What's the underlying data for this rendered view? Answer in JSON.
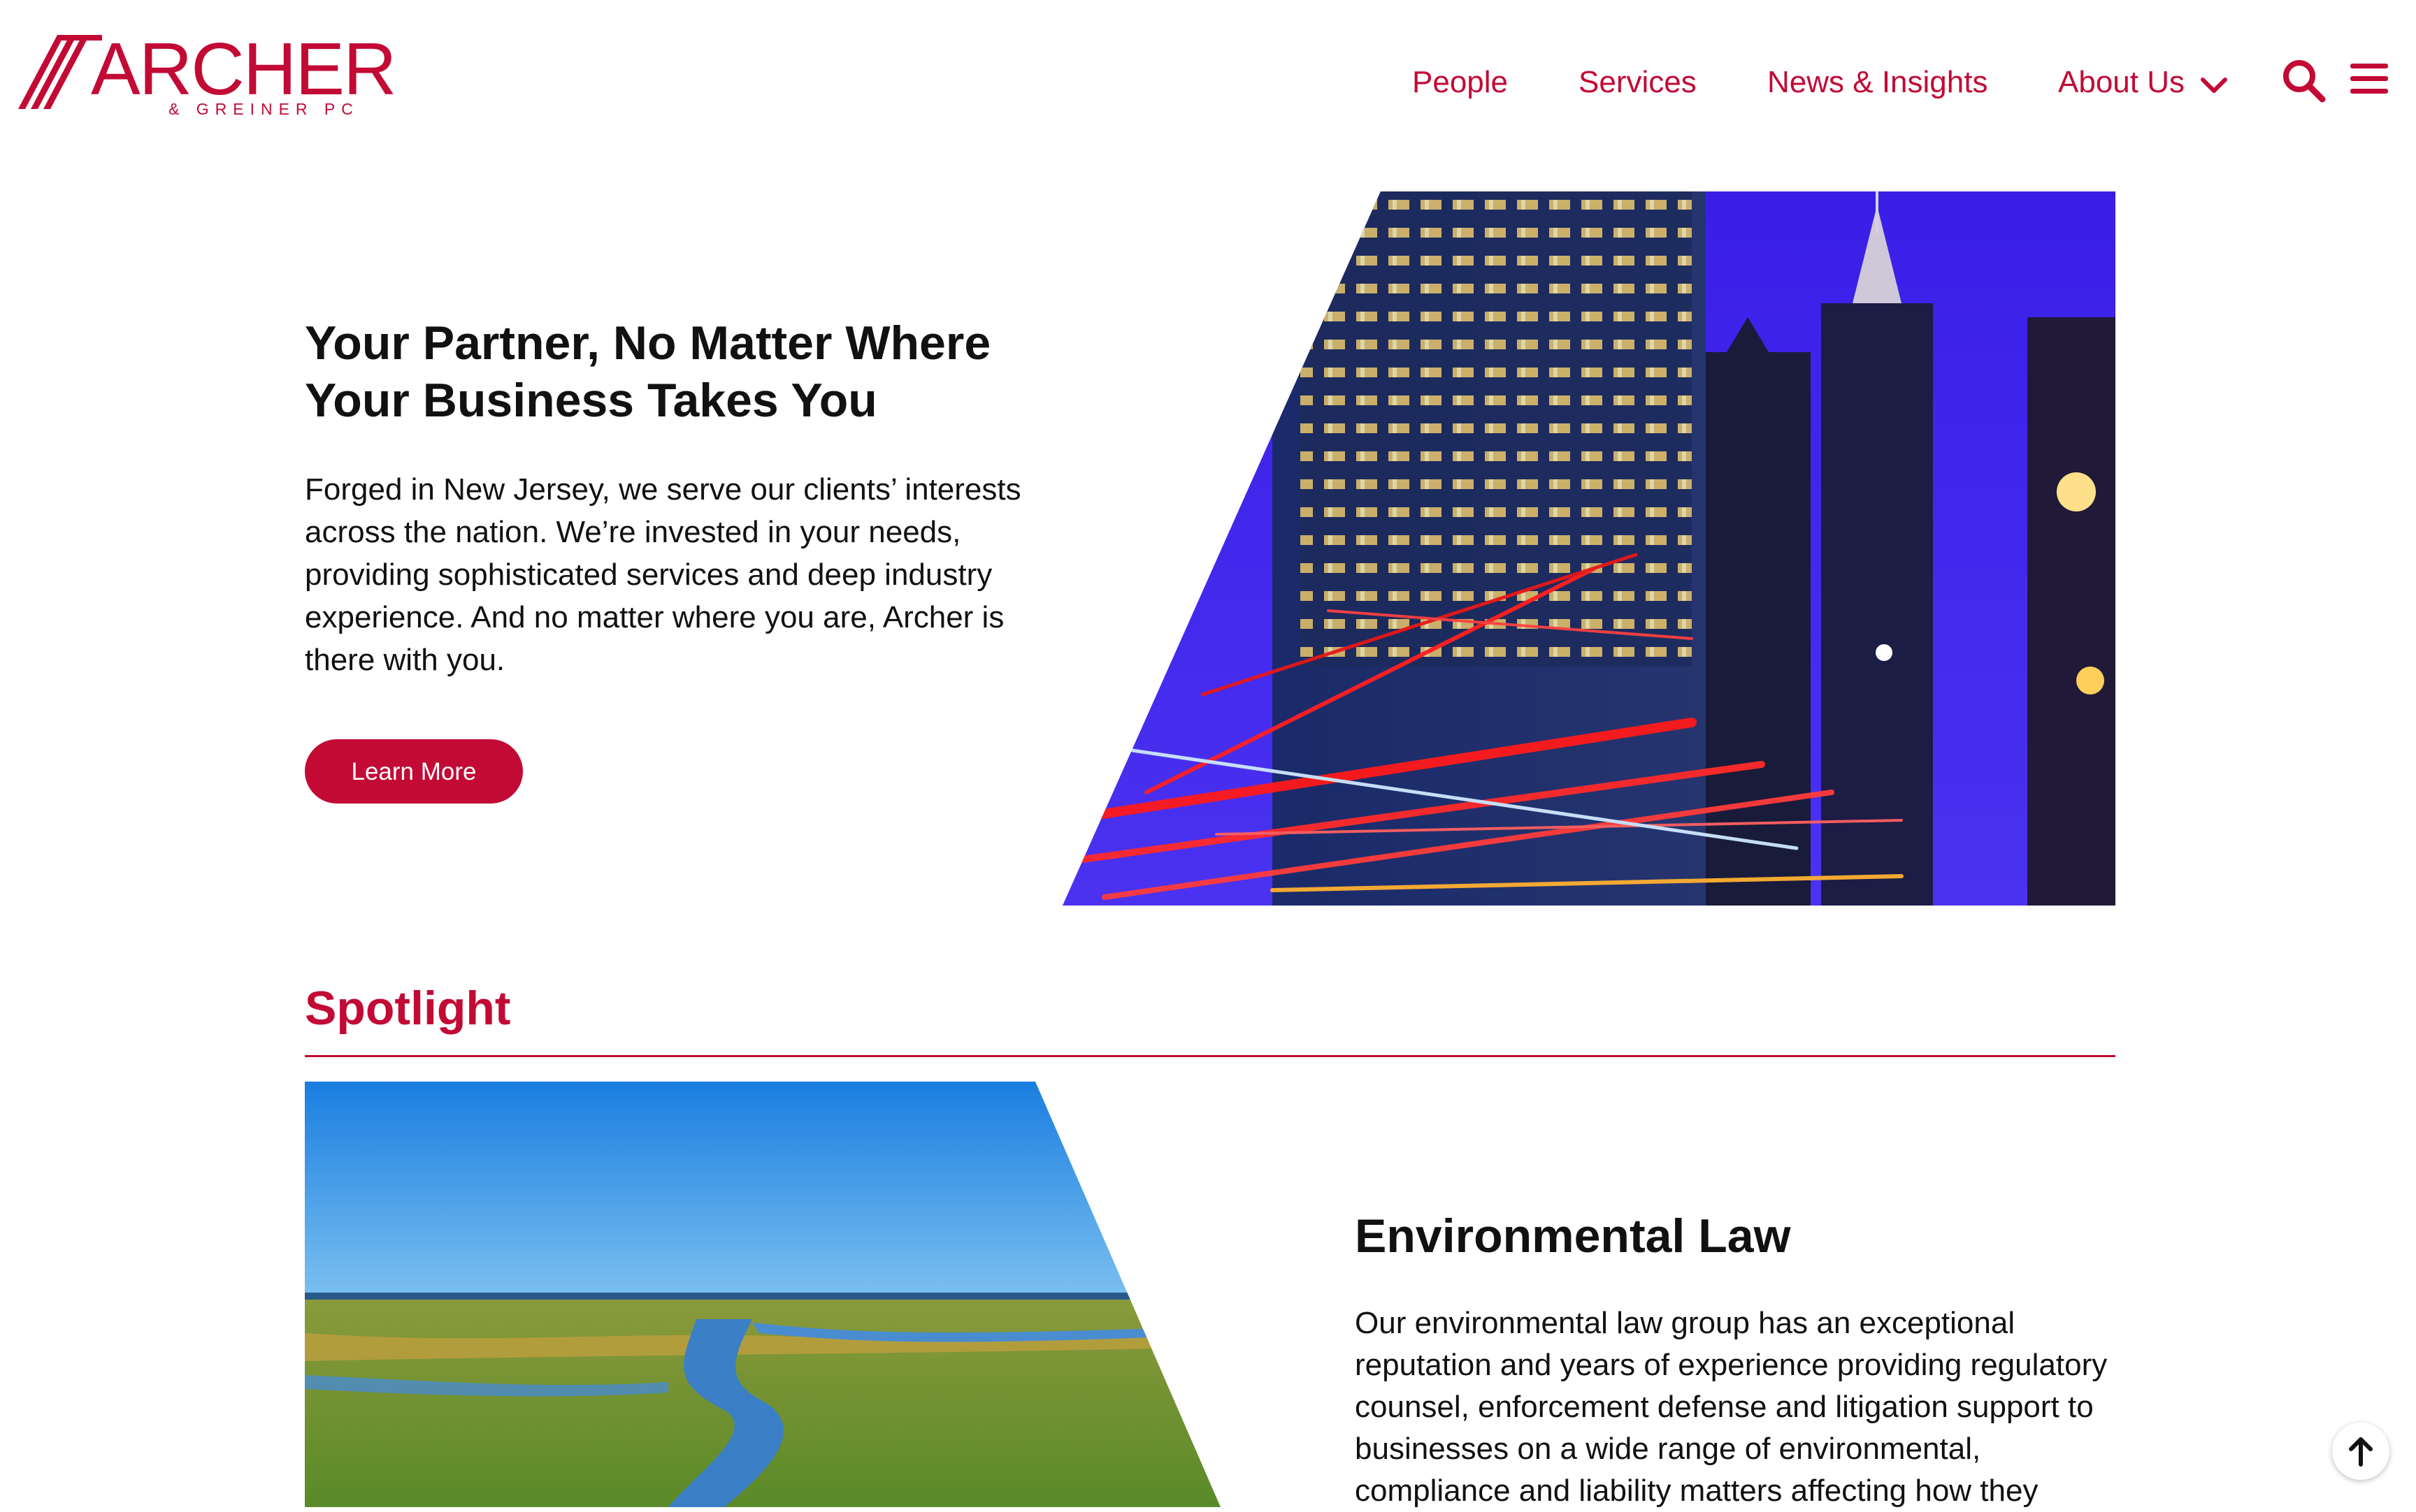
{
  "brand": {
    "name": "ARCHER",
    "subtitle": "& GREINER PC",
    "color": "#c20a35"
  },
  "nav": {
    "items": [
      {
        "label": "People"
      },
      {
        "label": "Services"
      },
      {
        "label": "News & Insights"
      },
      {
        "label": "About Us"
      }
    ],
    "about_dropdown_icon": "chevron-down-icon",
    "search_icon": "search-icon",
    "menu_icon": "hamburger-menu-icon"
  },
  "hero": {
    "title": "Your Partner, No Matter Where Your Business Takes You",
    "text": "Forged in New Jersey, we serve our clients’ interests across the nation. We’re invested in your needs, providing sophisticated services and deep industry experience. And no matter where you are, Archer is there with you.",
    "button": "Learn More",
    "image_icon": "city-night-traffic-image"
  },
  "spotlight": {
    "heading": "Spotlight",
    "title": "Environmental Law",
    "text": "Our environmental law group has an exceptional reputation and years of experience providing regulatory counsel, enforcement defense and litigation support to businesses on a wide range of environmental, compliance and liability matters affecting how they",
    "image_icon": "wetlands-river-image"
  },
  "back_to_top_icon": "arrow-up-icon"
}
